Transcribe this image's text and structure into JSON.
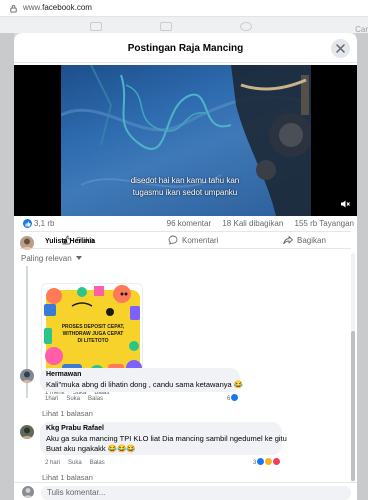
{
  "browser": {
    "url_prefix": "www.",
    "url_domain": "facebook.com"
  },
  "modal": {
    "title": "Postingan Raja Mancing"
  },
  "video": {
    "caption_line1": "disedot hai kan kamu tahu kan",
    "caption_line2": "tugasmu ikan sedot umpanku"
  },
  "stats": {
    "reactions": "3,1 rb",
    "comments": "96 komentar",
    "shares": "18 Kali dibagikan",
    "views": "155 rb Tayangan"
  },
  "actions": {
    "like": "Suka",
    "comment": "Komentari",
    "share": "Bagikan"
  },
  "sort": {
    "label": "Paling relevan"
  },
  "comments": [
    {
      "name": "Yulista Herlinia",
      "promo_text": "PROSES DEPOSIT CEPAT, WITHDRAW JUGA CEPAT DI LITETOTO",
      "time": "1 menit",
      "like": "Suka",
      "reply": "Balas"
    },
    {
      "name": "Hermawan",
      "text": "Kali\"muka abng di lihatin dong , candu sama ketawanya 😂",
      "time": "1hari",
      "like": "Suka",
      "reply": "Balas",
      "reaction_count": "6",
      "see_replies": "Lihat 1 balasan"
    },
    {
      "name": "Kkg Prabu Rafael",
      "text_line1": "Aku ga suka mancing TPI KLO liat Dia mancing sambil ngedumel ke gitu",
      "text_line2": "Buat aku ngakakk 😂😂😂",
      "time": "2 hari",
      "like": "Suka",
      "reply": "Balas",
      "reaction_count": "3",
      "see_replies": "Lihat 1 balasan"
    }
  ],
  "composer": {
    "placeholder": "Tulis komentar..."
  },
  "colors": {
    "brand": "#1877f2",
    "bubble": "#f0f2f5",
    "muted": "#65676b"
  }
}
